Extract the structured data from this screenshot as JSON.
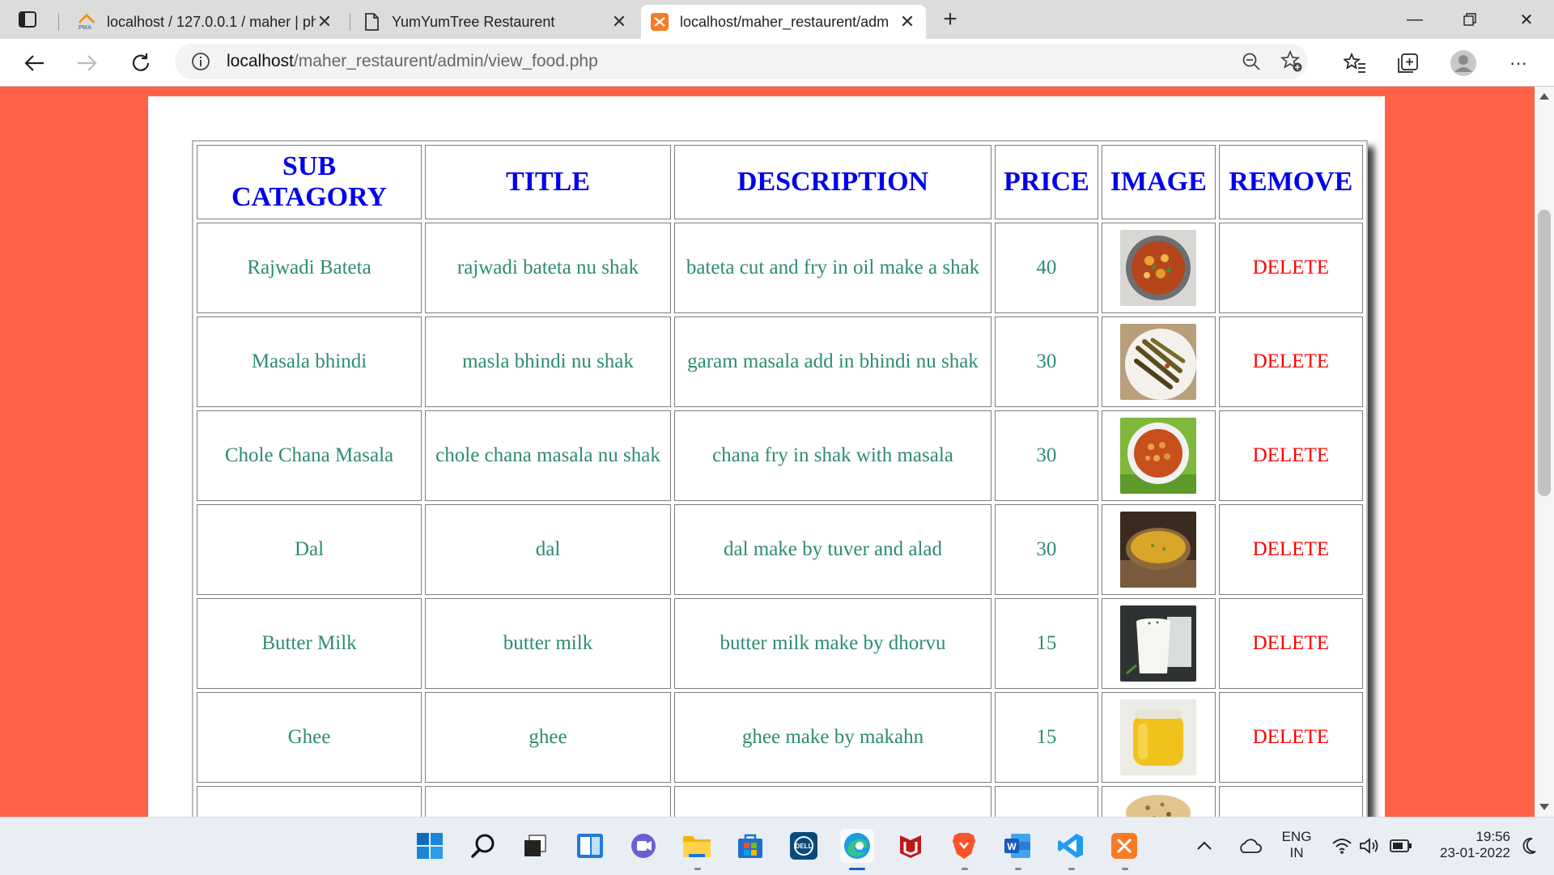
{
  "browser": {
    "tabs": [
      {
        "title": "localhost / 127.0.0.1 / maher | ph",
        "favicon": "phpmyadmin-icon",
        "active": false
      },
      {
        "title": "YumYumTree Restaurent",
        "favicon": "page-icon",
        "active": false
      },
      {
        "title": "localhost/maher_restaurent/adm",
        "favicon": "xampp-icon",
        "active": true
      }
    ],
    "favicon_label": "PMA",
    "address": {
      "host": "localhost",
      "path": "/maher_restaurent/admin/view_food.php"
    }
  },
  "table": {
    "headers": {
      "sub_category": "SUB CATAGORY",
      "title": "TITLE",
      "description": "DESCRIPTION",
      "price": "PRICE",
      "image": "IMAGE",
      "remove": "REMOVE"
    },
    "rows": [
      {
        "sub_category": "Rajwadi Bateta",
        "title": "rajwadi bateta nu shak",
        "description": "bateta cut and fry in oil make a shak",
        "price": "40",
        "image": "potato-curry-image",
        "remove": "DELETE"
      },
      {
        "sub_category": "Masala bhindi",
        "title": "masla bhindi nu shak",
        "description": "garam masala add in bhindi nu shak",
        "price": "30",
        "image": "okra-fry-image",
        "remove": "DELETE"
      },
      {
        "sub_category": "Chole Chana Masala",
        "title": "chole chana masala nu shak",
        "description": "chana fry in shak with masala",
        "price": "30",
        "image": "chana-masala-image",
        "remove": "DELETE"
      },
      {
        "sub_category": "Dal",
        "title": "dal",
        "description": "dal make by tuver and alad",
        "price": "30",
        "image": "dal-bowl-image",
        "remove": "DELETE"
      },
      {
        "sub_category": "Butter Milk",
        "title": "butter milk",
        "description": "butter milk make by dhorvu",
        "price": "15",
        "image": "buttermilk-glass-image",
        "remove": "DELETE"
      },
      {
        "sub_category": "Ghee",
        "title": "ghee",
        "description": "ghee make by makahn",
        "price": "15",
        "image": "ghee-jar-image",
        "remove": "DELETE"
      }
    ]
  },
  "taskbar": {
    "language": "ENG",
    "region": "IN",
    "time": "19:56",
    "date": "23-01-2022"
  },
  "colors": {
    "page_background": "#ff6347",
    "header_text": "#0000ee",
    "cell_text": "#2e8b74",
    "delete_text": "#ff0000"
  }
}
